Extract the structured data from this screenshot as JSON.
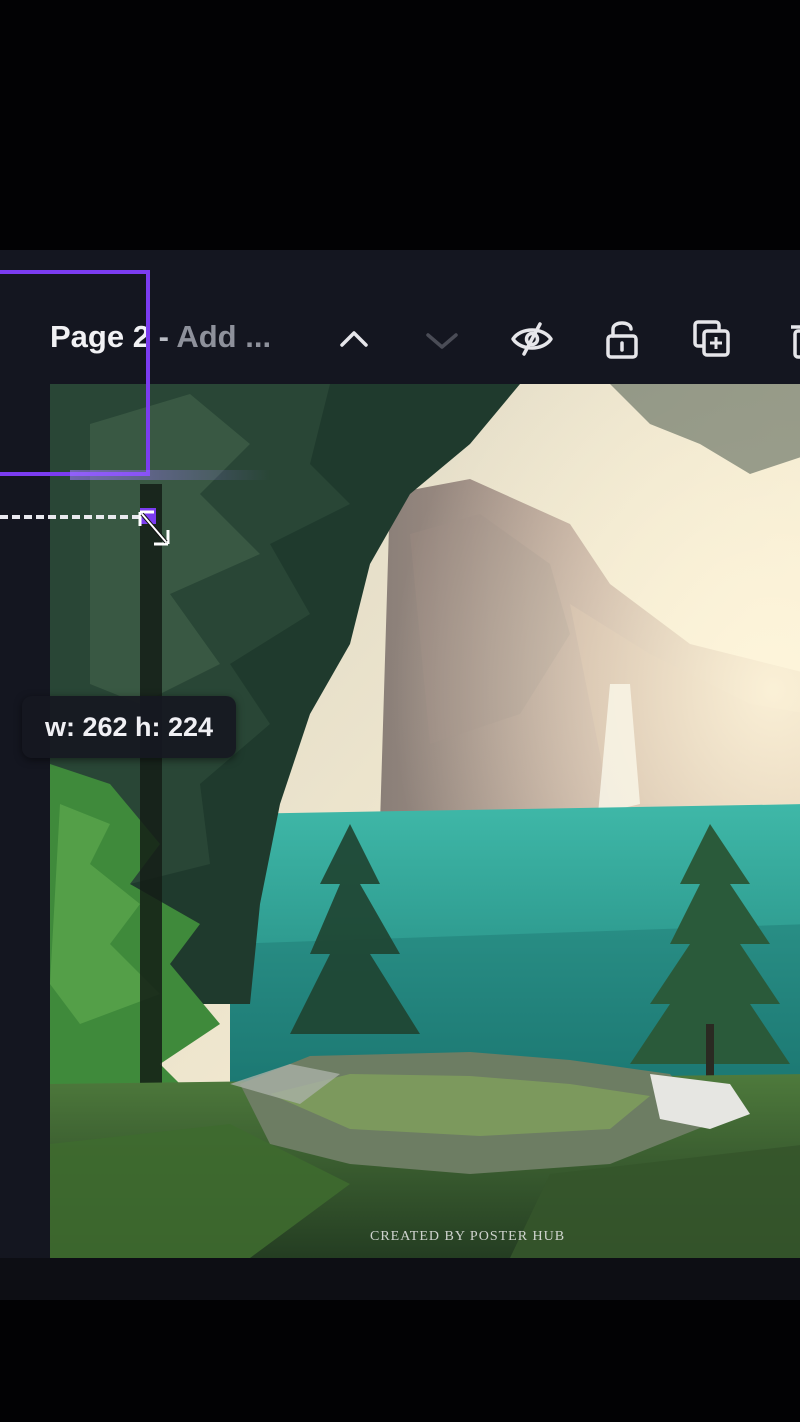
{
  "page_header": {
    "title": "Page 2",
    "separator": " - ",
    "subtitle": "Add ..."
  },
  "toolbar": {
    "icons": [
      "chevron-up-icon",
      "chevron-down-icon",
      "eye-hidden-icon",
      "unlock-icon",
      "duplicate-page-icon",
      "trash-icon"
    ]
  },
  "canvas": {
    "credit_text": "CREATED BY POSTER HUB"
  },
  "resize_tooltip": {
    "text": "w: 262 h: 224"
  },
  "colors": {
    "selection": "#7b3cf0",
    "background": "#020204",
    "editor_surface": "#141620",
    "lake": "#2fa89a"
  }
}
